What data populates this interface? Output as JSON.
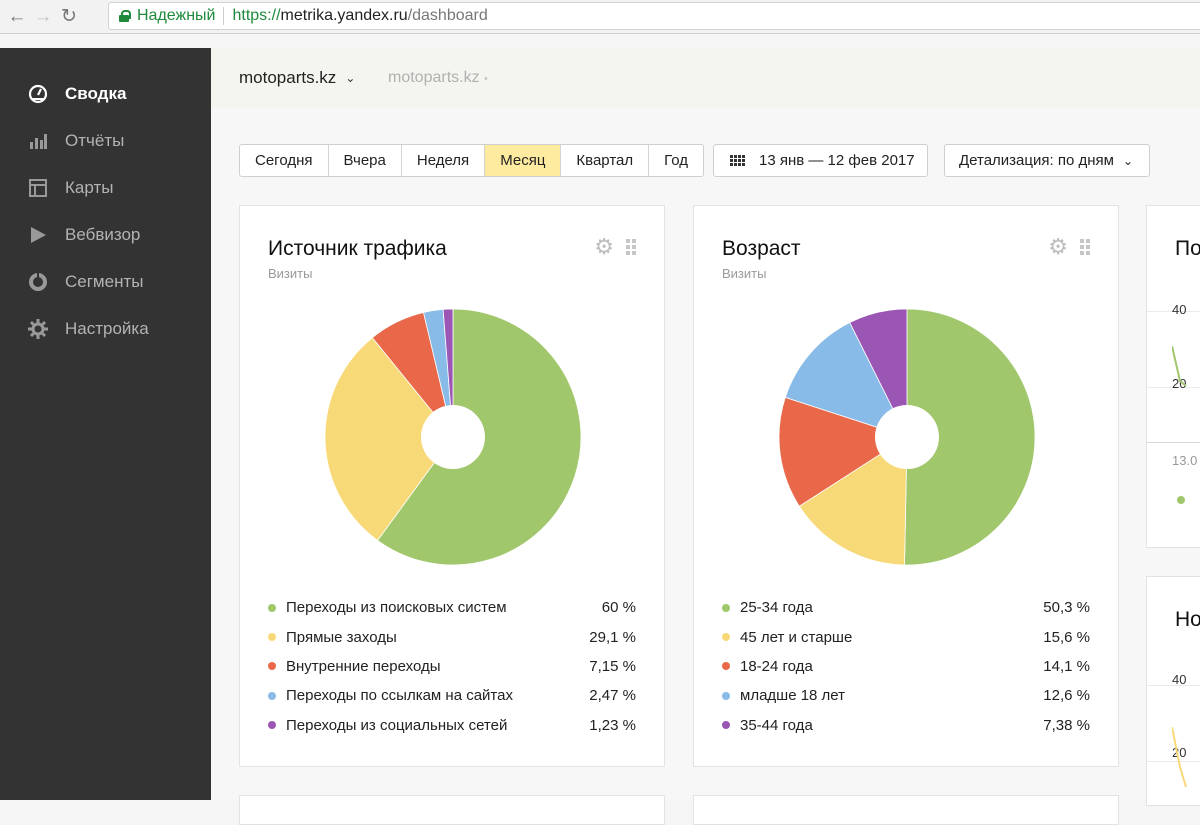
{
  "browser": {
    "secure_label": "Надежный",
    "url_scheme": "https://",
    "url_host": "metrika.yandex.ru",
    "url_path": "/dashboard"
  },
  "sidebar": {
    "items": [
      {
        "label": "Сводка",
        "icon": "dashboard-gauge-icon",
        "active": true
      },
      {
        "label": "Отчёты",
        "icon": "bar-chart-icon",
        "active": false
      },
      {
        "label": "Карты",
        "icon": "map-layout-icon",
        "active": false
      },
      {
        "label": "Вебвизор",
        "icon": "play-icon",
        "active": false
      },
      {
        "label": "Сегменты",
        "icon": "segments-ring-icon",
        "active": false
      },
      {
        "label": "Настройка",
        "icon": "gear-icon",
        "active": false
      }
    ]
  },
  "header": {
    "site": "motoparts.kz",
    "site_secondary": "motoparts.kz"
  },
  "toolbar": {
    "periods": [
      "Сегодня",
      "Вчера",
      "Неделя",
      "Месяц",
      "Квартал",
      "Год"
    ],
    "selected_period": "Месяц",
    "date_range": "13 янв — 12 фев 2017",
    "detail": "Детализация: по дням"
  },
  "colors": {
    "green": "#a0c76b",
    "yellow": "#f8d978",
    "red": "#e9684a",
    "blue": "#89bbe8",
    "purple": "#9a55b5"
  },
  "widgets": {
    "traffic": {
      "title": "Источник трафика",
      "subtitle": "Визиты"
    },
    "age": {
      "title": "Возраст",
      "subtitle": "Визиты"
    },
    "right_top": {
      "title": "По",
      "axis": [
        "40",
        "20",
        "13.0"
      ]
    },
    "right_bottom": {
      "title": "Но",
      "axis": [
        "40",
        "20"
      ]
    }
  },
  "chart_data": [
    {
      "type": "pie",
      "title": "Источник трафика",
      "subtitle": "Визиты",
      "slices": [
        {
          "label": "Переходы из поисковых систем",
          "value": 60,
          "display": "60 %",
          "color": "#a0c76b"
        },
        {
          "label": "Прямые заходы",
          "value": 29.1,
          "display": "29,1 %",
          "color": "#f8d978"
        },
        {
          "label": "Внутренние переходы",
          "value": 7.15,
          "display": "7,15 %",
          "color": "#e9684a"
        },
        {
          "label": "Переходы по ссылкам на сайтах",
          "value": 2.47,
          "display": "2,47 %",
          "color": "#89bbe8"
        },
        {
          "label": "Переходы из социальных сетей",
          "value": 1.23,
          "display": "1,23 %",
          "color": "#9a55b5"
        }
      ]
    },
    {
      "type": "pie",
      "title": "Возраст",
      "subtitle": "Визиты",
      "slices": [
        {
          "label": "25-34 года",
          "value": 50.3,
          "display": "50,3 %",
          "color": "#a0c76b"
        },
        {
          "label": "45 лет и старше",
          "value": 15.6,
          "display": "15,6 %",
          "color": "#f8d978"
        },
        {
          "label": "18-24 года",
          "value": 14.1,
          "display": "14,1 %",
          "color": "#e9684a"
        },
        {
          "label": "младше 18 лет",
          "value": 12.6,
          "display": "12,6 %",
          "color": "#89bbe8"
        },
        {
          "label": "35-44 года",
          "value": 7.38,
          "display": "7,38 %",
          "color": "#9a55b5"
        }
      ]
    }
  ]
}
